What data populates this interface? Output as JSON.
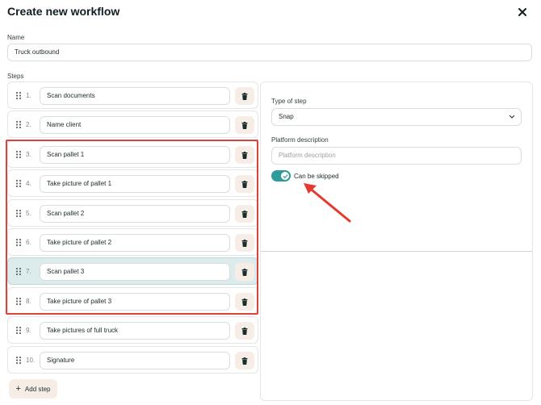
{
  "dialog": {
    "title": "Create new workflow"
  },
  "name_section": {
    "label": "Name",
    "value": "Truck outbound"
  },
  "steps_section": {
    "label": "Steps",
    "steps": [
      {
        "number": "1.",
        "text": "Scan documents"
      },
      {
        "number": "2.",
        "text": "Name client"
      },
      {
        "number": "3.",
        "text": "Scan pallet 1"
      },
      {
        "number": "4.",
        "text": "Take picture of pallet 1"
      },
      {
        "number": "5.",
        "text": "Scan pallet 2"
      },
      {
        "number": "6.",
        "text": "Take picture of pallet 2"
      },
      {
        "number": "7.",
        "text": "Scan pallet 3",
        "selected": true
      },
      {
        "number": "8.",
        "text": "Take picture of pallet 3"
      },
      {
        "number": "9.",
        "text": "Take pictures of full truck"
      },
      {
        "number": "10.",
        "text": "Signature"
      }
    ],
    "add_step_label": "Add step"
  },
  "step_details": {
    "type_label": "Type of step",
    "type_value": "Snap",
    "description_label": "Platform description",
    "description_placeholder": "Platform description",
    "skip_toggle_label": "Can be skipped",
    "skip_toggle_on": true
  },
  "colors": {
    "accent": "#2f9b9b",
    "selected_row": "#dcecec",
    "delete_button_bg": "#f6eee6",
    "highlight_border": "#d9433b"
  },
  "icons": {
    "close": "close-icon",
    "drag": "drag-handle-icon",
    "delete": "trash-icon",
    "add": "plus-icon",
    "dropdown": "chevron-down-icon",
    "toggle": "check-icon"
  }
}
